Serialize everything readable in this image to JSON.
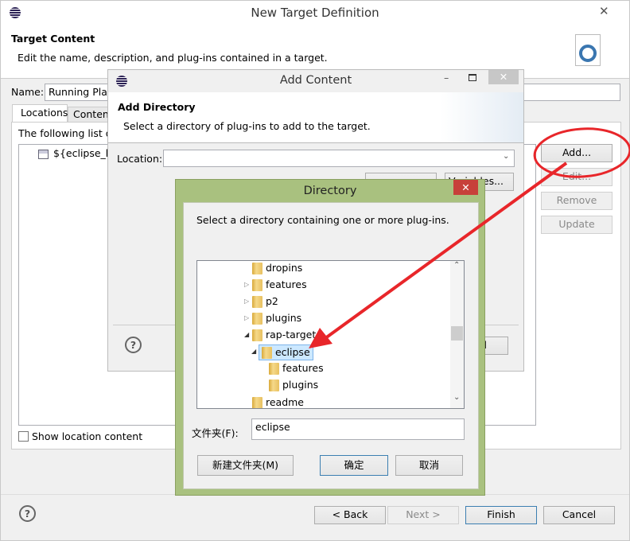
{
  "main": {
    "title": "New Target Definition",
    "header_title": "Target Content",
    "header_desc": "Edit the name, description, and plug-ins contained in a target.",
    "name_label": "Name:",
    "name_value": "Running Platf",
    "tabs": [
      "Locations",
      "Content"
    ],
    "list_intro": "The following list of",
    "locations": [
      "${eclipse_ho"
    ],
    "buttons": {
      "add": "Add...",
      "edit": "Edit...",
      "remove": "Remove",
      "update": "Update"
    },
    "show_location": "Show location content",
    "back": "< Back",
    "next": "Next >",
    "finish": "Finish",
    "cancel": "Cancel"
  },
  "add_content": {
    "title": "Add Content",
    "header_title": "Add Directory",
    "header_desc": "Select a directory of plug-ins to add to the target.",
    "location_label": "Location:",
    "location_value": "",
    "variables": "Variables...",
    "cancel_partial": "el"
  },
  "directory": {
    "title": "Directory",
    "prompt": "Select a directory containing one or more plug-ins.",
    "tree": [
      {
        "label": "dropins",
        "level": 1,
        "expander": ""
      },
      {
        "label": "features",
        "level": 1,
        "expander": "▷"
      },
      {
        "label": "p2",
        "level": 1,
        "expander": "▷"
      },
      {
        "label": "plugins",
        "level": 1,
        "expander": "▷"
      },
      {
        "label": "rap-target",
        "level": 1,
        "expander": "◢"
      },
      {
        "label": "eclipse",
        "level": 2,
        "expander": "◢",
        "selected": true
      },
      {
        "label": "features",
        "level": 3,
        "expander": ""
      },
      {
        "label": "plugins",
        "level": 3,
        "expander": ""
      },
      {
        "label": "readme",
        "level": 1,
        "expander": ""
      }
    ],
    "folder_label": "文件夹(F):",
    "folder_value": "eclipse",
    "new_folder": "新建文件夹(M)",
    "ok": "确定",
    "cancel": "取消"
  },
  "colors": {
    "directory_border": "#a9c17f",
    "close_red": "#c7403a",
    "annotation": "#e8262a",
    "selection": "#cce8ff"
  }
}
